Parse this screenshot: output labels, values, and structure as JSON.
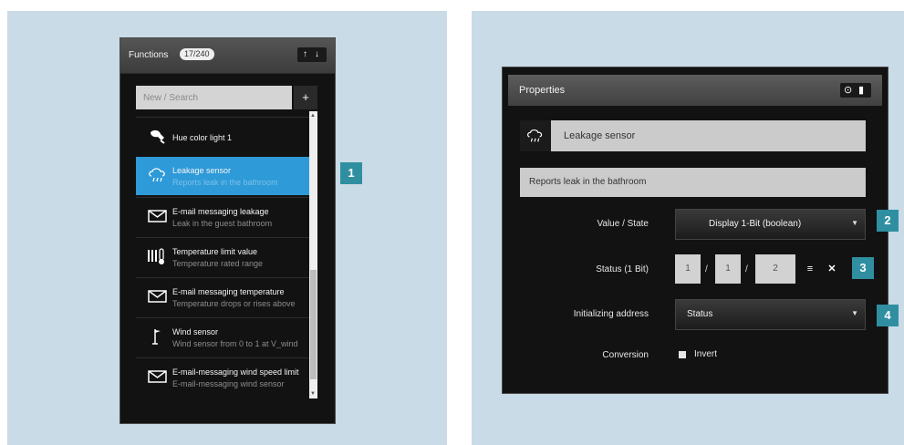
{
  "functions": {
    "title": "Functions",
    "count_badge": "17/240",
    "sort_up": "↑",
    "sort_down": "↓",
    "search_placeholder": "New / Search",
    "add_symbol": "+",
    "items": [
      {
        "name": "Hue color light 1",
        "description": "",
        "icon": "light-bulb-icon",
        "selected": false
      },
      {
        "name": "Leakage sensor",
        "description": "Reports leak in the bathroom",
        "icon": "leak-sensor-icon",
        "selected": true
      },
      {
        "name": "E-mail messaging leakage",
        "description": "Leak in the guest bathroom",
        "icon": "envelope-icon",
        "selected": false
      },
      {
        "name": "Temperature limit value",
        "description": "Temperature rated range",
        "icon": "thermometer-icon",
        "selected": false
      },
      {
        "name": "E-mail messaging temperature",
        "description": "Temperature drops or rises above",
        "icon": "envelope-icon",
        "selected": false
      },
      {
        "name": "Wind sensor",
        "description": "Wind sensor from 0 to 1 at V_wind",
        "icon": "flag-icon",
        "selected": false
      },
      {
        "name": "E-mail-messaging wind speed limit",
        "description": "E-mail-messaging wind sensor",
        "icon": "envelope-icon",
        "selected": false
      }
    ]
  },
  "properties": {
    "title": "Properties",
    "name_value": "Leakage sensor",
    "description_value": "Reports leak in the bathroom",
    "value_state_label": "Value / State",
    "value_state_selected": "Display 1-Bit (boolean)",
    "status_label": "Status (1 Bit)",
    "status_address": [
      "1",
      "1",
      "2"
    ],
    "status_separator": "/",
    "initializing_label": "Initializing address",
    "initializing_selected": "Status",
    "conversion_label": "Conversion",
    "invert_label": "Invert",
    "invert_checked": false
  },
  "callouts": [
    "1",
    "2",
    "3",
    "4"
  ],
  "colors": {
    "background_panel": "#c9dbe6",
    "selection_blue": "#2e9ad8",
    "callout_teal": "#2f8fa1"
  }
}
